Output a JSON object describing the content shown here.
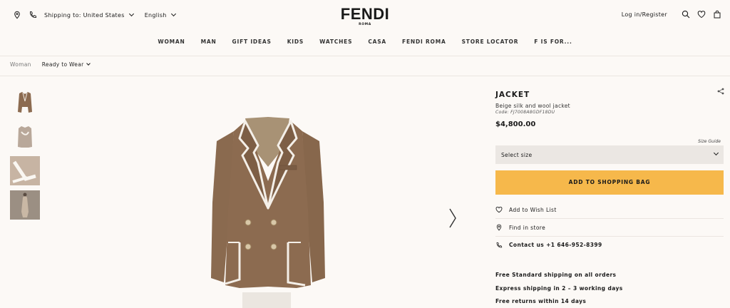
{
  "header": {
    "shipping_label": "Shipping to: United States",
    "language": "English",
    "brand": "FENDI",
    "brand_sub": "ROMA",
    "login": "Log in/Register",
    "icons": [
      "location-pin-icon",
      "phone-icon",
      "search-icon",
      "heart-icon",
      "shopping-bag-icon"
    ]
  },
  "nav": [
    "WOMAN",
    "MAN",
    "GIFT IDEAS",
    "KIDS",
    "WATCHES",
    "CASA",
    "FENDI ROMA",
    "STORE LOCATOR",
    "F IS FOR..."
  ],
  "breadcrumb": {
    "item1": "Woman",
    "item2": "Ready to Wear"
  },
  "product": {
    "title": "JACKET",
    "description": "Beige silk and wool jacket",
    "code": "Code: FJ7008A8GDF18DU",
    "price": "$4,800.00",
    "size_guide": "Size Guide",
    "select_size": "Select size",
    "add_to_bag": "ADD TO SHOPPING BAG",
    "wishlist": "Add to Wish List",
    "find_store": "Find in store",
    "contact": "Contact us +1 646-952-8399"
  },
  "shipping_info": [
    "Free Standard shipping on all orders",
    "Express shipping in 2 – 3 working days",
    "Free returns within 14 days"
  ],
  "colors": {
    "background": "#fcf9f6",
    "accent": "#f6b84b",
    "select_bg": "#ebe7e3",
    "jacket": "#8c6b50"
  }
}
